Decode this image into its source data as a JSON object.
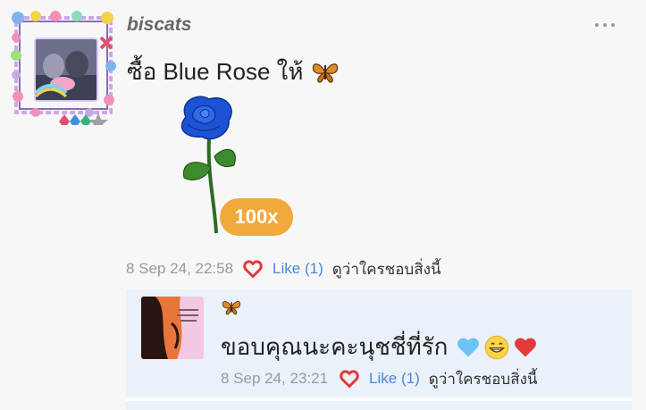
{
  "post": {
    "username": "biscats",
    "gift_text": "ซื้อ Blue Rose ให้",
    "quantity_badge": "100x",
    "timestamp": "8 Sep 24, 22:58",
    "like_label": "Like",
    "like_count": "(1)",
    "who_liked": "ดูว่าใครชอบสิ่งนี้"
  },
  "reply": {
    "text": "ขอบคุณนะคะนุชชี่ที่รัก",
    "timestamp": "8 Sep 24, 23:21",
    "like_label": "Like",
    "like_count": "(1)",
    "who_liked": "ดูว่าใครชอบสิ่งนี้"
  },
  "colors": {
    "badge": "#f2a93b",
    "like_link": "#4b86d6",
    "heart": "#e4393c",
    "reply_bg": "#eaf1fb",
    "rose": "#1e52d6"
  },
  "icons": [
    "butterfly-icon",
    "blue-rose-image",
    "heart-outline-icon",
    "blue-heart-emoji",
    "grinning-face-emoji",
    "red-heart-emoji",
    "more-options-icon"
  ]
}
